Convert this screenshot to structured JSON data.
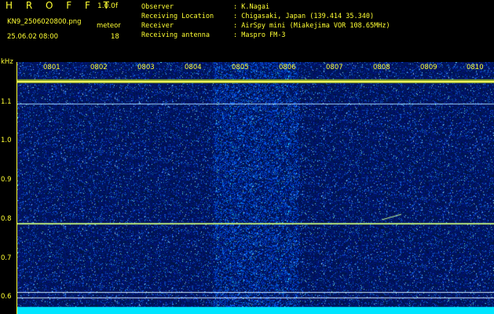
{
  "header": {
    "app_title": "H R O F F T",
    "version": "1.0.0f",
    "filename": "KN9_2506020800.png",
    "datetime": "25.06.02 08:00",
    "meteor_label": "meteor",
    "meteor_count": "18"
  },
  "info": [
    {
      "key": "Observer",
      "value": ": K.Nagai"
    },
    {
      "key": "Receiving Location",
      "value": ": Chigasaki, Japan (139.414 35.340)"
    },
    {
      "key": "Receiver",
      "value": ": AirSpy mini (Miakejima VOR 108.65MHz)"
    },
    {
      "key": "Receiving antenna",
      "value": ": Maspro FM-3"
    }
  ],
  "axes": {
    "y_unit": "kHz",
    "y_ticks": [
      "1.1",
      "1.0",
      "0.9",
      "0.8",
      "0.7",
      "0.6"
    ],
    "x_ticks": [
      "0801",
      "0802",
      "0803",
      "0804",
      "0805",
      "0806",
      "0807",
      "0808",
      "0809",
      "0810"
    ]
  },
  "colors": {
    "text": "#ffff33",
    "background": "#000000",
    "noise_dark": "#000a5a",
    "noise_mid": "#1e3cc8",
    "carrier": "#ffff66",
    "base_band": "#00e5ff"
  }
}
